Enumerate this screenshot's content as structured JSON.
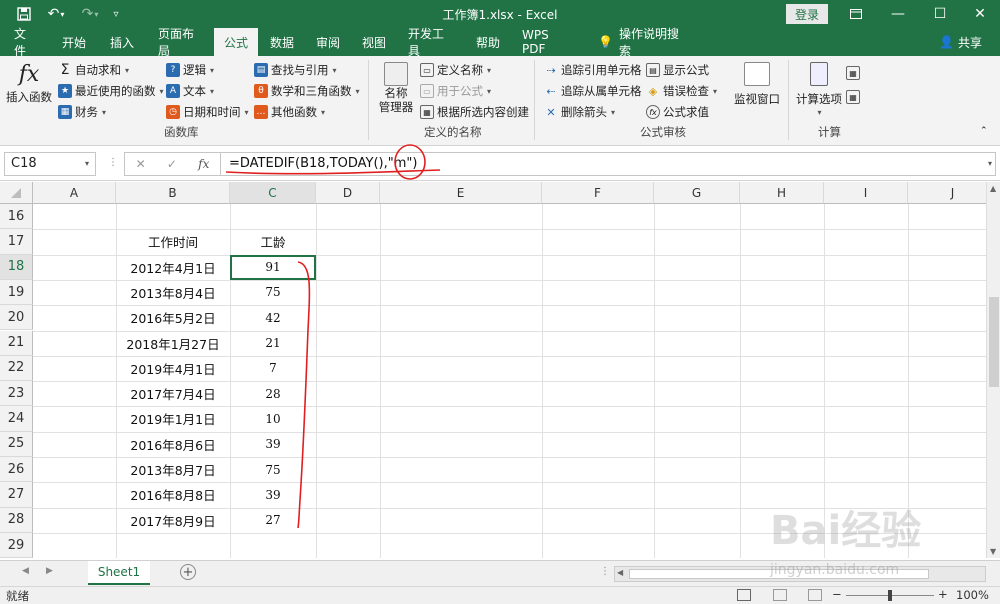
{
  "window": {
    "title": "工作簿1.xlsx  -  Excel",
    "login_label": "登录"
  },
  "tabs": [
    "文件",
    "开始",
    "插入",
    "页面布局",
    "公式",
    "数据",
    "审阅",
    "视图",
    "开发工具",
    "帮助",
    "WPS PDF",
    "操作说明搜索"
  ],
  "active_tab": "公式",
  "share_label": "共享",
  "ribbon": {
    "insert_function": "插入函数",
    "function_library": {
      "autosum": "自动求和",
      "recent": "最近使用的函数",
      "financial": "财务",
      "logical": "逻辑",
      "text": "文本",
      "datetime": "日期和时间",
      "lookup": "查找与引用",
      "math": "数学和三角函数",
      "other": "其他函数",
      "label": "函数库"
    },
    "defined_names": {
      "name_manager_line1": "名称",
      "name_manager_line2": "管理器",
      "define_name": "定义名称",
      "use_in_formula": "用于公式",
      "create_from_selection": "根据所选内容创建",
      "label": "定义的名称"
    },
    "auditing": {
      "trace_precedents": "追踪引用单元格",
      "trace_dependents": "追踪从属单元格",
      "remove_arrows": "删除箭头",
      "show_formulas": "显示公式",
      "error_checking": "错误检查",
      "evaluate_formula": "公式求值",
      "watch_window": "监视窗口",
      "label": "公式审核"
    },
    "calculation": {
      "options": "计算选项",
      "label": "计算"
    }
  },
  "formula_bar": {
    "name_box": "C18",
    "formula": "=DATEDIF(B18,TODAY(),\"m\")"
  },
  "grid": {
    "columns": [
      "A",
      "B",
      "C",
      "D",
      "E",
      "F",
      "G",
      "H",
      "I",
      "J"
    ],
    "rows": [
      "16",
      "17",
      "18",
      "19",
      "20",
      "21",
      "22",
      "23",
      "24",
      "25",
      "26",
      "27",
      "28",
      "29"
    ],
    "header_b": "工作时间",
    "header_c": "工龄",
    "data": [
      {
        "date": "2012年4月1日",
        "months": "91"
      },
      {
        "date": "2013年8月4日",
        "months": "75"
      },
      {
        "date": "2016年5月2日",
        "months": "42"
      },
      {
        "date": "2018年1月27日",
        "months": "21"
      },
      {
        "date": "2019年4月1日",
        "months": "7"
      },
      {
        "date": "2017年7月4日",
        "months": "28"
      },
      {
        "date": "2019年1月1日",
        "months": "10"
      },
      {
        "date": "2016年8月6日",
        "months": "39"
      },
      {
        "date": "2013年8月7日",
        "months": "75"
      },
      {
        "date": "2016年8月8日",
        "months": "39"
      },
      {
        "date": "2017年8月9日",
        "months": "27"
      }
    ]
  },
  "sheet_tab": "Sheet1",
  "status": {
    "ready": "就绪",
    "zoom": "100%"
  },
  "watermark": {
    "line1": "Bai经验",
    "line2": "jingyan.baidu.com"
  },
  "colors": {
    "excel_green": "#217346",
    "annotation_red": "#e02020"
  }
}
